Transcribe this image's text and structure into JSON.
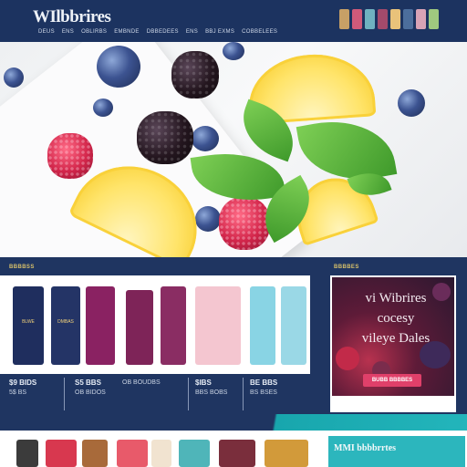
{
  "header": {
    "logo": "WIlbbrires",
    "nav": [
      "DEUS",
      "ENS",
      "OBLIRBS",
      "EMBNDE",
      "DBBEDEES",
      "ENS",
      "BBJ EXMS",
      "COBBELEES"
    ],
    "thumb_colors": [
      "#c7a066",
      "#d05a7a",
      "#6fb2c0",
      "#a24a6b",
      "#e9c27a",
      "#4c6e9c",
      "#d8a3b6",
      "#9fc97f"
    ]
  },
  "products": {
    "section_label": "BBBBSS",
    "items": [
      {
        "label": "BLWE",
        "color": "#1f2e5e"
      },
      {
        "label": "DMBAS",
        "color": "#243466"
      },
      {
        "label": "",
        "color": "#8a2262"
      },
      {
        "label": "",
        "color": "#7e2458"
      },
      {
        "label": "",
        "color": "#8a2d63"
      },
      {
        "label": "",
        "color": "#f4c6d0"
      },
      {
        "label": "",
        "color": "#89d4e4"
      },
      {
        "label": "",
        "color": "#9ad8e6"
      }
    ],
    "prices": [
      {
        "line1": "$9 BIDS",
        "line2": "5$ BS"
      },
      {
        "line1": "S5 BBS",
        "line2": "OB BIDOS"
      },
      {
        "line1": "",
        "line2": "OB BOUDBS"
      },
      {
        "line1": "$IBS",
        "line2": "BBS BOBS"
      },
      {
        "line1": "BE BBS",
        "line2": "BS BSES"
      }
    ]
  },
  "promo": {
    "section_label": "BBBBES",
    "title_line1": "vi Wibrires",
    "title_line2": "cocesy",
    "title_line3": "vileye Dales",
    "button": "BUBB BBBBES"
  },
  "bottom": {
    "title": "MMI bbbbrrtes",
    "tile_colors": [
      "#3b3b3b",
      "#d8384f",
      "#a86a3a",
      "#e85a6a",
      "#f1e3d0",
      "#4fb5b9",
      "#7a2e3c",
      "#d29a3a"
    ]
  }
}
